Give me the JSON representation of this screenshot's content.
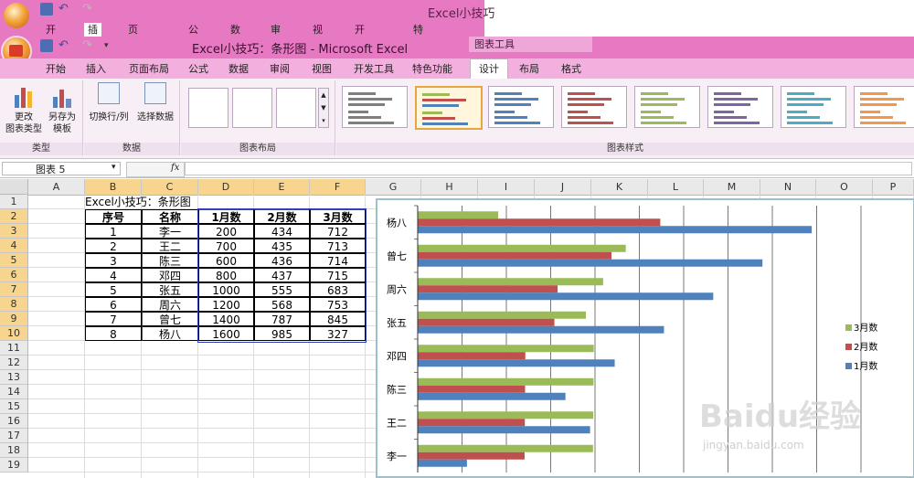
{
  "back_window": {
    "title": "Excel小技巧",
    "tabs": [
      "开始",
      "插入",
      "页面布局",
      "公式",
      "数据",
      "审阅",
      "视图",
      "开发工具",
      "特色功能"
    ]
  },
  "window": {
    "title": "Excel小技巧：条形图 - Microsoft Excel",
    "contextual_tool": "图表工具"
  },
  "tabs": [
    "开始",
    "插入",
    "页面布局",
    "公式",
    "数据",
    "审阅",
    "视图",
    "开发工具",
    "特色功能",
    "设计",
    "布局",
    "格式"
  ],
  "active_tab": "设计",
  "ribbon": {
    "type_group": {
      "caption": "类型",
      "change_type_l1": "更改",
      "change_type_l2": "图表类型",
      "save_tpl_l1": "另存为",
      "save_tpl_l2": "模板"
    },
    "data_group": {
      "caption": "数据",
      "switch": "切换行/列",
      "select": "选择数据"
    },
    "layout_group": {
      "caption": "图表布局"
    },
    "style_group": {
      "caption": "图表样式"
    },
    "style_colors": [
      "#7f7f7f",
      "#4f81bd",
      "#4f81bd",
      "#c0504d",
      "#9bbb59",
      "#8064a2",
      "#4bacc6",
      "#f79646"
    ],
    "style_selected_index": 1
  },
  "formula_bar": {
    "name_box": "图表 5",
    "fx": "fx"
  },
  "columns": [
    "A",
    "B",
    "C",
    "D",
    "E",
    "F",
    "G",
    "H",
    "I",
    "J",
    "K",
    "L",
    "M",
    "N",
    "O",
    "P"
  ],
  "rows": [
    "1",
    "2",
    "3",
    "4",
    "5",
    "6",
    "7",
    "8",
    "9",
    "10",
    "11",
    "12",
    "13",
    "14",
    "15",
    "16",
    "17",
    "18",
    "19"
  ],
  "sheet": {
    "title": "Excel小技巧：条形图",
    "headers": [
      "序号",
      "名称",
      "1月数",
      "2月数",
      "3月数"
    ],
    "rows": [
      [
        "1",
        "李一",
        "200",
        "434",
        "712"
      ],
      [
        "2",
        "王二",
        "700",
        "435",
        "713"
      ],
      [
        "3",
        "陈三",
        "600",
        "436",
        "714"
      ],
      [
        "4",
        "邓四",
        "800",
        "437",
        "715"
      ],
      [
        "5",
        "张五",
        "1000",
        "555",
        "683"
      ],
      [
        "6",
        "周六",
        "1200",
        "568",
        "753"
      ],
      [
        "7",
        "曾七",
        "1400",
        "787",
        "845"
      ],
      [
        "8",
        "杨八",
        "1600",
        "985",
        "327"
      ]
    ]
  },
  "chart_data": {
    "type": "bar",
    "categories": [
      "李一",
      "王二",
      "陈三",
      "邓四",
      "张五",
      "周六",
      "曾七",
      "杨八"
    ],
    "series": [
      {
        "name": "1月数",
        "color": "#4f81bd",
        "values": [
          200,
          700,
          600,
          800,
          1000,
          1200,
          1400,
          1600
        ]
      },
      {
        "name": "2月数",
        "color": "#c0504d",
        "values": [
          434,
          435,
          436,
          437,
          555,
          568,
          787,
          985
        ]
      },
      {
        "name": "3月数",
        "color": "#9bbb59",
        "values": [
          712,
          713,
          714,
          715,
          683,
          753,
          845,
          327
        ]
      }
    ],
    "xlim": [
      0,
      1800
    ],
    "grid": true,
    "legend": "right"
  },
  "watermark": {
    "brand": "Baidu经验",
    "url": "jingyan.baidu.com"
  }
}
